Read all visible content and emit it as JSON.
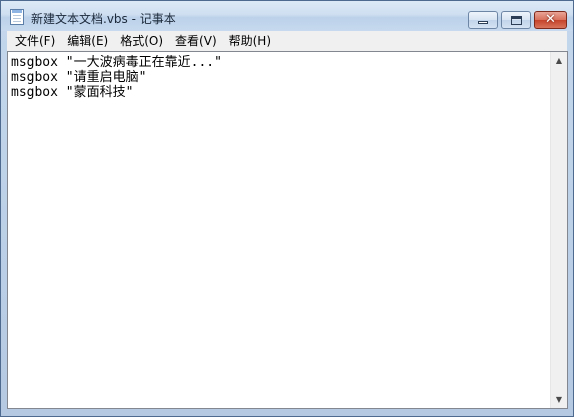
{
  "window": {
    "title": "新建文本文档.vbs - 记事本",
    "minimize_icon": "minimize-icon",
    "maximize_icon": "maximize-icon",
    "close_glyph": "✕"
  },
  "menu": {
    "items": [
      {
        "label": "文件(F)"
      },
      {
        "label": "编辑(E)"
      },
      {
        "label": "格式(O)"
      },
      {
        "label": "查看(V)"
      },
      {
        "label": "帮助(H)"
      }
    ]
  },
  "editor": {
    "lines": [
      "msgbox \"一大波病毒正在靠近...\"",
      "msgbox \"请重启电脑\"",
      "msgbox \"蒙面科技\""
    ]
  },
  "scrollbar": {
    "up_arrow": "▲",
    "down_arrow": "▼"
  }
}
